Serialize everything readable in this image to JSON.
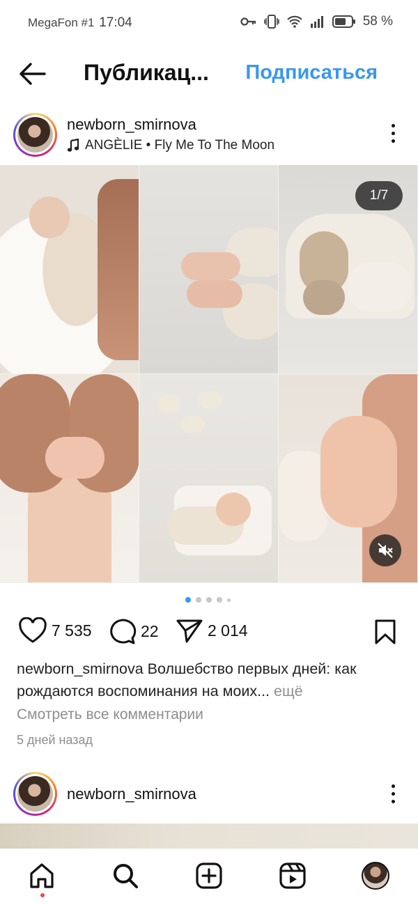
{
  "status_bar": {
    "carrier": "MegaFon #1",
    "time": "17:04",
    "battery": "58 %"
  },
  "header": {
    "title": "Публикац...",
    "follow_label": "Подписаться"
  },
  "post": {
    "username": "newborn_smirnova",
    "music": "ANGÈLIE • Fly Me To The Moon",
    "image_counter": "1/7",
    "likes": "7 535",
    "comments": "22",
    "shares": "2 014",
    "caption_user": "newborn_smirnova",
    "caption_text": "Волшебство первых дней: как рождаются воспоминания на моих...",
    "caption_more": "ещё",
    "view_comments": "Смотреть все комментарии",
    "posted_ago": "5 дней назад"
  },
  "next_post": {
    "username": "newborn_smirnova"
  },
  "colors": {
    "accent": "#3897f0",
    "notification": "#ed4956"
  },
  "nav": {
    "items": [
      "home-icon",
      "search-icon",
      "create-icon",
      "reels-icon",
      "profile-avatar"
    ]
  }
}
